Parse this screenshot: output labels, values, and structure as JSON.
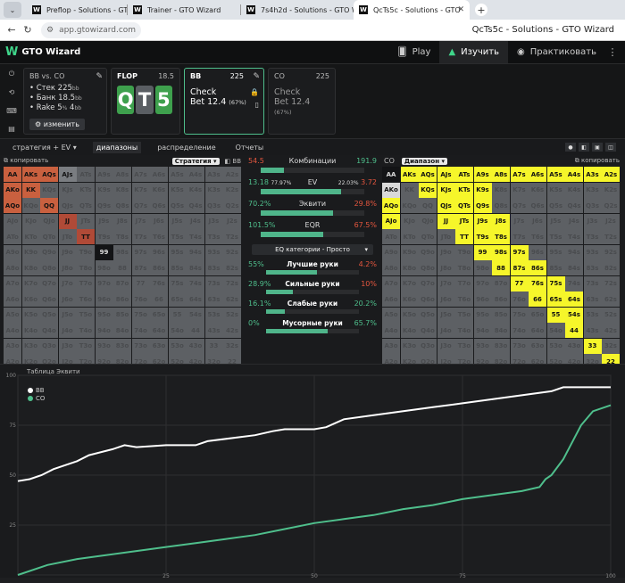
{
  "browser": {
    "tabs": [
      {
        "label": "Preflop - Solutions - GTO W",
        "active": false
      },
      {
        "label": "Trainer - GTO Wizard",
        "active": false
      },
      {
        "label": "7s4h2d - Solutions - GTO W",
        "active": false
      },
      {
        "label": "QcTs5c - Solutions - GTO",
        "active": true
      }
    ],
    "url": "app.gtowizard.com",
    "window_title": "QcTs5c - Solutions - GTO Wizard"
  },
  "app": {
    "logo": "GTO Wizard",
    "nav": [
      {
        "label": "Play",
        "icon": "cards-icon"
      },
      {
        "label": "Изучить",
        "icon": "grad-cap-icon",
        "selected": true
      },
      {
        "label": "Практиковать",
        "icon": "gamepad-icon"
      }
    ]
  },
  "spot": {
    "matchup": "BB vs. CO",
    "stack": "Стек 225",
    "stack_unit": "bb",
    "pot": "Банк 18.5",
    "pot_unit": "bb",
    "rake": "Rake 5",
    "rake_pct": "%",
    "rake_cap": "4",
    "rake_unit": "bb",
    "change_btn": "изменить",
    "flop_label": "FLOP",
    "flop_pot": "18.5",
    "board": [
      "Q",
      "T",
      "5"
    ],
    "bb_label": "BB",
    "bb_stack": "225",
    "bb_act1": "Check",
    "bb_act2": "Bet 12.4",
    "bb_act2_pct": "(67%)",
    "co_label": "CO",
    "co_stack": "225",
    "co_act1": "Check",
    "co_act2": "Bet 12.4",
    "co_act2_pct": "(67%)"
  },
  "subnav": {
    "items": [
      "стратегия + EV",
      "диапазоны",
      "распределение",
      "Отчеты"
    ],
    "selected": 1
  },
  "leftgrid": {
    "copy": "копировать",
    "dropdown": "Стратегия",
    "player": "BB"
  },
  "rightgrid": {
    "player": "CO",
    "dropdown": "Диапазон",
    "copy": "копировать"
  },
  "stats": [
    {
      "left": "54.5",
      "center": "Комбинации",
      "right": "191.9",
      "fill": 0.22,
      "lc": "rd",
      "rc": "gr"
    },
    {
      "left": "13.18",
      "left_pct": "77.97%",
      "center": "EV",
      "right_pct": "22.03%",
      "right": "3.72",
      "fill": 0.78,
      "lc": "gr",
      "rc": "rd"
    },
    {
      "left": "70.2%",
      "center": "Эквити",
      "right": "29.8%",
      "fill": 0.7,
      "lc": "gr",
      "rc": "rd"
    },
    {
      "left": "101.5%",
      "center": "EQR",
      "right": "67.5%",
      "fill": 0.6,
      "lc": "gr",
      "rc": "rd"
    }
  ],
  "eq_select": "EQ категории - Просто",
  "cats": [
    {
      "left": "55%",
      "center": "Лучшие руки",
      "right": "4.2%",
      "fill": 0.55
    },
    {
      "left": "28.9%",
      "center": "Сильные руки",
      "right": "10%",
      "fill": 0.29
    },
    {
      "left": "16.1%",
      "center": "Слабые руки",
      "right": "20.2%",
      "fill": 0.2,
      "rgreen": true
    },
    {
      "left": "0%",
      "center": "Мусорные руки",
      "right": "65.7%",
      "fill": 0.66,
      "rgreen": true
    }
  ],
  "chart": {
    "title": "Таблица Эквити",
    "legend": [
      {
        "name": "BB",
        "color": "#ffffff"
      },
      {
        "name": "CO",
        "color": "#4fbf8c"
      }
    ],
    "yticks": [
      "100",
      "75",
      "50",
      "25"
    ],
    "xticks": [
      "25",
      "50",
      "75",
      "100"
    ]
  },
  "chart_data": {
    "type": "line",
    "title": "Таблица Эквити",
    "xlim": [
      0,
      100
    ],
    "ylim": [
      0,
      100
    ],
    "series": [
      {
        "name": "BB",
        "x": [
          0,
          2,
          4,
          6,
          8,
          10,
          12,
          16,
          18,
          20,
          25,
          30,
          32,
          40,
          43,
          45,
          50,
          52,
          55,
          60,
          65,
          70,
          75,
          80,
          85,
          90,
          92,
          95,
          100
        ],
        "y": [
          47,
          48,
          50,
          53,
          55,
          57,
          60,
          63,
          65,
          64,
          65,
          65,
          67,
          70,
          72,
          73,
          73,
          74,
          78,
          80,
          82,
          84,
          86,
          88,
          90,
          92,
          94,
          94,
          94
        ]
      },
      {
        "name": "CO",
        "x": [
          0,
          5,
          10,
          15,
          20,
          25,
          30,
          35,
          40,
          45,
          50,
          55,
          60,
          65,
          70,
          75,
          80,
          85,
          88,
          89,
          90,
          92,
          95,
          97,
          100
        ],
        "y": [
          0,
          5,
          8,
          10,
          12,
          14,
          16,
          18,
          20,
          23,
          26,
          28,
          30,
          33,
          35,
          38,
          40,
          42,
          44,
          48,
          50,
          58,
          75,
          82,
          85
        ]
      }
    ]
  }
}
